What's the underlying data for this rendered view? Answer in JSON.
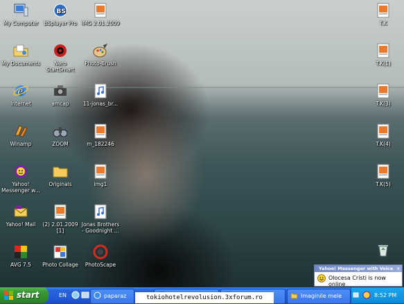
{
  "desktop": {
    "icons_left": [
      {
        "label": "My Computer",
        "icon": "my-computer-icon"
      },
      {
        "label": "My Documents",
        "icon": "my-documents-icon"
      },
      {
        "label": "Internet",
        "icon": "internet-explorer-icon"
      },
      {
        "label": "Winamp",
        "icon": "winamp-icon"
      },
      {
        "label": "Yahoo!\nMessenger w...",
        "icon": "yahoo-messenger-icon"
      },
      {
        "label": "Yahoo! Mail",
        "icon": "yahoo-mail-icon"
      },
      {
        "label": "AVG 7.5",
        "icon": "avg-antivirus-icon"
      }
    ],
    "icons_col2": [
      {
        "label": "BSplayer Pro",
        "icon": "bsplayer-icon"
      },
      {
        "label": "Nero\nStartSmart",
        "icon": "nero-icon"
      },
      {
        "label": "amcap",
        "icon": "webcam-icon"
      },
      {
        "label": "ZOOM",
        "icon": "zoom-icon"
      },
      {
        "label": "Originals",
        "icon": "folder-icon"
      },
      {
        "label": "(2) 2.01.2009\n[1]",
        "icon": "image-file-icon"
      },
      {
        "label": "Photo Collage",
        "icon": "photo-collage-icon"
      }
    ],
    "icons_col3": [
      {
        "label": "IMG 2.01.2009",
        "icon": "image-file-icon"
      },
      {
        "label": "Photo-Brush",
        "icon": "photo-brush-icon"
      },
      {
        "label": "11-jonas_br...",
        "icon": "audio-file-icon"
      },
      {
        "label": "m_182246",
        "icon": "image-file-icon"
      },
      {
        "label": "img1",
        "icon": "image-file-icon"
      },
      {
        "label": "Jonas Brothers\n- Goodnight ...",
        "icon": "audio-file-icon"
      },
      {
        "label": "PhotoScape",
        "icon": "photoscape-icon"
      }
    ],
    "icons_right": [
      {
        "label": "T.K",
        "icon": "image-file-icon"
      },
      {
        "label": "T.K(1)",
        "icon": "image-file-icon"
      },
      {
        "label": "T.K(3)",
        "icon": "image-file-icon"
      },
      {
        "label": "T.K(4)",
        "icon": "image-file-icon"
      },
      {
        "label": "T.K(5)",
        "icon": "image-file-icon"
      }
    ],
    "recycle_bin": {
      "label": "",
      "icon": "recycle-bin-icon"
    }
  },
  "taskbar": {
    "start_label": "start",
    "language": "EN",
    "buttons": [
      {
        "label": "paparaz",
        "icon": "browser-icon"
      },
      {
        "label": "",
        "icon": "window-icon"
      },
      {
        "label": "",
        "icon": "window-icon"
      },
      {
        "label": "Imaginile mele",
        "icon": "folder-icon"
      }
    ],
    "clock": "8:52 PM"
  },
  "notification": {
    "title": "Yahoo! Messenger with Voice",
    "message": "Olocesa Cristi is now online"
  },
  "watermark": "tokiohotelrevolusion.3xforum.ro",
  "colors": {
    "taskbar_blue": "#245edb",
    "start_green": "#3a9a36",
    "tray_blue": "#0f8ad8"
  }
}
